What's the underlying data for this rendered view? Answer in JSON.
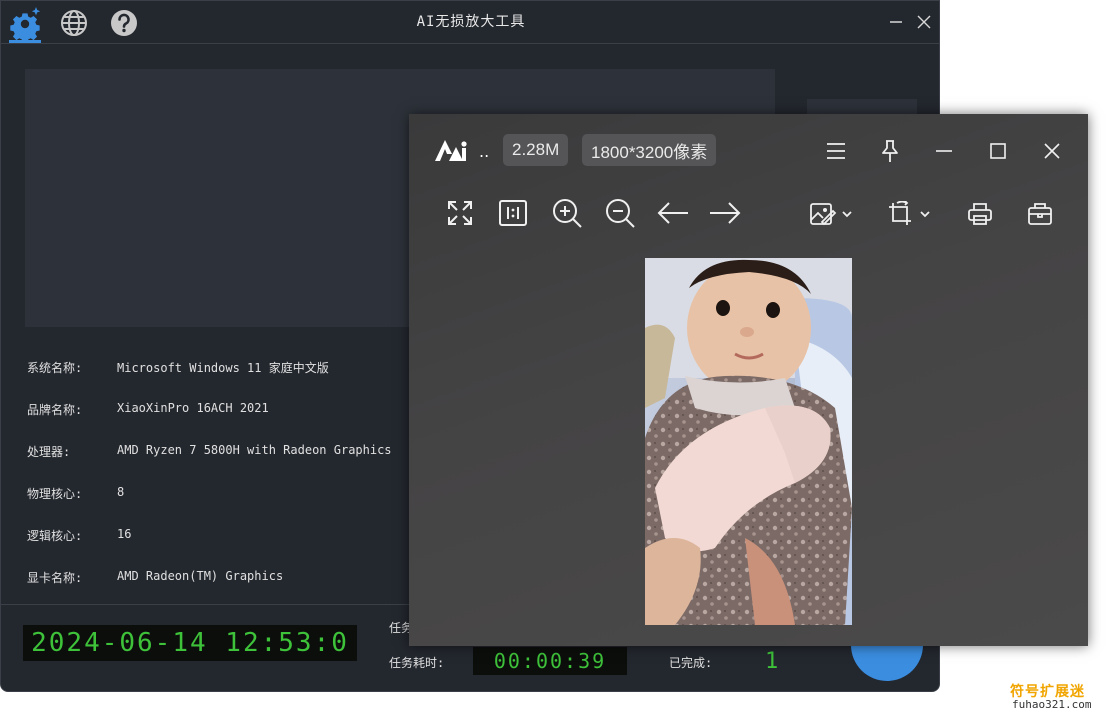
{
  "app": {
    "title": "AI无损放大工具",
    "system_info": [
      {
        "label": "系统名称:",
        "value": "Microsoft Windows 11 家庭中文版"
      },
      {
        "label": "品牌名称:",
        "value": "XiaoXinPro 16ACH 2021"
      },
      {
        "label": "处理器:",
        "value": "AMD Ryzen 7 5800H with Radeon Graphics"
      },
      {
        "label": "物理核心:",
        "value": "8"
      },
      {
        "label": "逻辑核心:",
        "value": "16"
      },
      {
        "label": "显卡名称:",
        "value": "AMD Radeon(TM) Graphics"
      }
    ],
    "clock": "2024-06-14 12:53:0",
    "task_label_partial": "任务",
    "task_time_label": "任务耗时:",
    "task_time": "00:00:39",
    "completed_label": "已完成:",
    "completed_count": "1",
    "icons": {
      "settings": "gear-icon",
      "language": "globe-icon",
      "help": "question-icon"
    },
    "accent_color": "#3b8de0",
    "lcd_color": "#3ec23a"
  },
  "viewer": {
    "file_size": "2.28M",
    "dimensions": "1800*3200像素",
    "ellipsis": "..",
    "toolbar_icons": [
      "fit-screen-icon",
      "actual-size-icon",
      "zoom-in-icon",
      "zoom-out-icon",
      "previous-icon",
      "next-icon",
      "edit-image-icon",
      "rotate-crop-icon",
      "print-icon",
      "toolbox-icon"
    ],
    "window_icons": [
      "menu-icon",
      "pin-icon",
      "minimize-icon",
      "maximize-icon",
      "close-icon"
    ]
  },
  "watermark": {
    "name": "符号扩展迷",
    "url": "fuhao321.com"
  }
}
